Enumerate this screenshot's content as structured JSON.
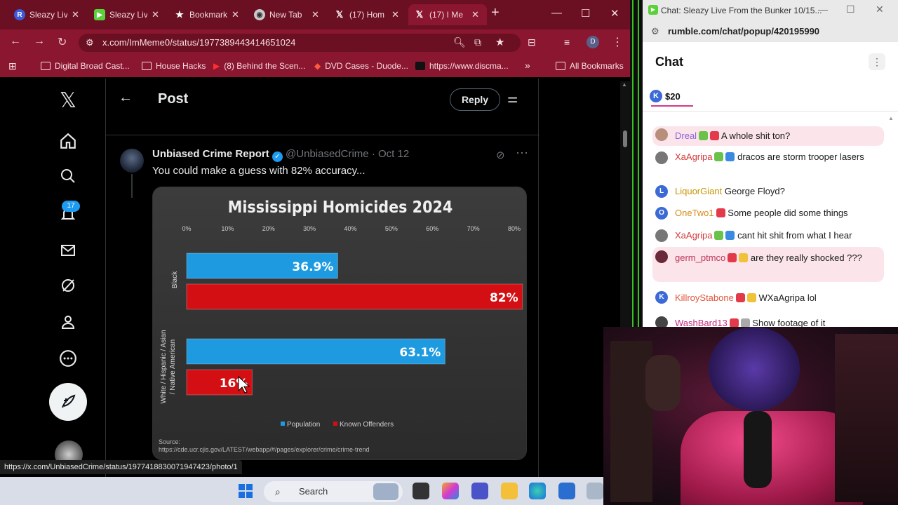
{
  "browser": {
    "tabs": [
      {
        "label": "Sleazy Liv",
        "icon": "R"
      },
      {
        "label": "Sleazy Liv",
        "icon": "rumble"
      },
      {
        "label": "Bookmarks",
        "icon": "star"
      },
      {
        "label": "New Tab",
        "icon": "chrome"
      },
      {
        "label": "(17) Hom",
        "icon": "X"
      },
      {
        "label": "(17) I Me",
        "icon": "X"
      }
    ],
    "url": "x.com/ImMeme0/status/1977389443414651024",
    "profile_initial": "D",
    "bookmarks": [
      "Digital Broad Cast...",
      "House Hacks",
      "(8) Behind the Scen...",
      "DVD Cases - Duode...",
      "https://www.discma...",
      "»",
      "All Bookmarks"
    ]
  },
  "x": {
    "notif_count": "17",
    "post_title": "Post",
    "reply_label": "Reply",
    "tweet": {
      "author": "Unbiased Crime Report",
      "handle": "@UnbiasedCrime · Oct 12",
      "text": "You could make a guess with 82% accuracy..."
    },
    "status_url": "https://x.com/UnbiasedCrime/status/1977418830071947423/photo/1"
  },
  "chart_data": {
    "type": "bar",
    "orientation": "horizontal",
    "title": "Mississippi Homicides 2024",
    "categories": [
      "Black",
      "White / Hispanic / Asian / Native American"
    ],
    "series": [
      {
        "name": "Population",
        "values": [
          36.9,
          63.1
        ],
        "color": "#1e9be0"
      },
      {
        "name": "Known Offenders",
        "values": [
          82,
          16
        ],
        "color": "#d40f14"
      }
    ],
    "data_labels": [
      [
        "36.9%",
        "63.1%"
      ],
      [
        "82%",
        "16%"
      ]
    ],
    "xticks": [
      "0%",
      "10%",
      "20%",
      "30%",
      "40%",
      "50%",
      "60%",
      "70%",
      "80%"
    ],
    "xlim": [
      0,
      80
    ],
    "legend_position": "bottom",
    "source_label": "Source:",
    "source": "https://cde.ucr.cjis.gov/LATEST/webapp/#/pages/explorer/crime/crime-trend"
  },
  "chat": {
    "window_title": "Chat: Sleazy Live From the Bunker 10/15...",
    "url": "rumble.com/chat/popup/420195990",
    "header": "Chat",
    "rant_amount": "$20",
    "messages": [
      {
        "user": "Dreal",
        "text": "A whole shit ton?",
        "color": "#8e62d9",
        "avatar": "D"
      },
      {
        "user": "XaAgripa",
        "text": "dracos are storm trooper lasers",
        "color": "#d23a3a",
        "avatar": "X"
      },
      {
        "user": "LiquorGiant",
        "text": "George Floyd?",
        "color": "#c79400",
        "avatar": "L"
      },
      {
        "user": "OneTwo1",
        "text": "Some people did some things",
        "color": "#d98a1a",
        "avatar": "O"
      },
      {
        "user": "XaAgripa",
        "text": "cant hit shit from what I hear",
        "color": "#d23a3a",
        "avatar": "X"
      },
      {
        "user": "germ_ptmco",
        "text": "are they really shocked ???",
        "color": "#c0365a",
        "avatar": "g"
      },
      {
        "user": "KillroyStabone",
        "text": "WXaAgripa lol",
        "color": "#e0553a",
        "avatar": "K"
      },
      {
        "user": "WashBard13",
        "text": "Show footage of it",
        "color": "#c02a7a",
        "avatar": "W"
      }
    ]
  },
  "taskbar": {
    "search_placeholder": "Search"
  },
  "colors": {
    "chrome": "#8a1630",
    "chrome_dark": "#6b0f22",
    "x_blue": "#1d9bf0"
  }
}
